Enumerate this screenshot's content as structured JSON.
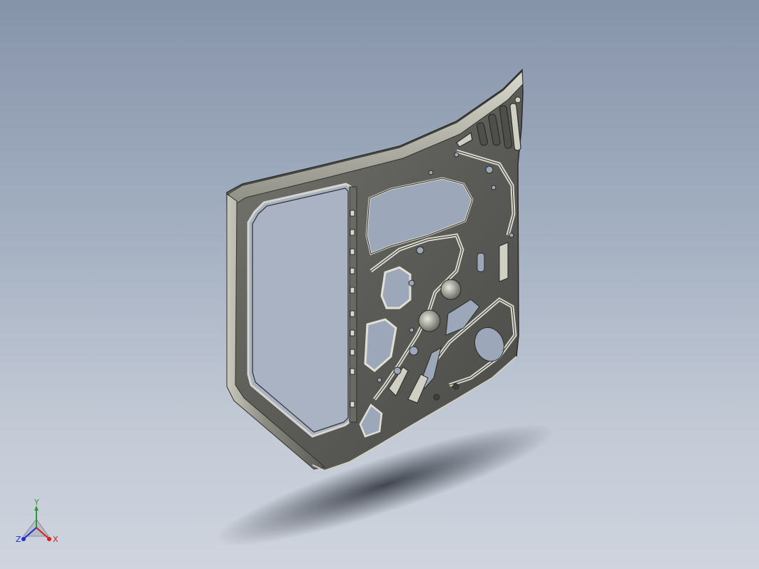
{
  "viewport": {
    "model": "door-inner-panel",
    "background_top": "#8694aa",
    "background_bottom": "#cfd4de",
    "part_color": "#6b6b6b"
  },
  "triad": {
    "x_label": "X",
    "y_label": "Y",
    "z_label": "Z",
    "x_color": "#d22020",
    "y_color": "#2aa02a",
    "z_color": "#2030d0"
  }
}
